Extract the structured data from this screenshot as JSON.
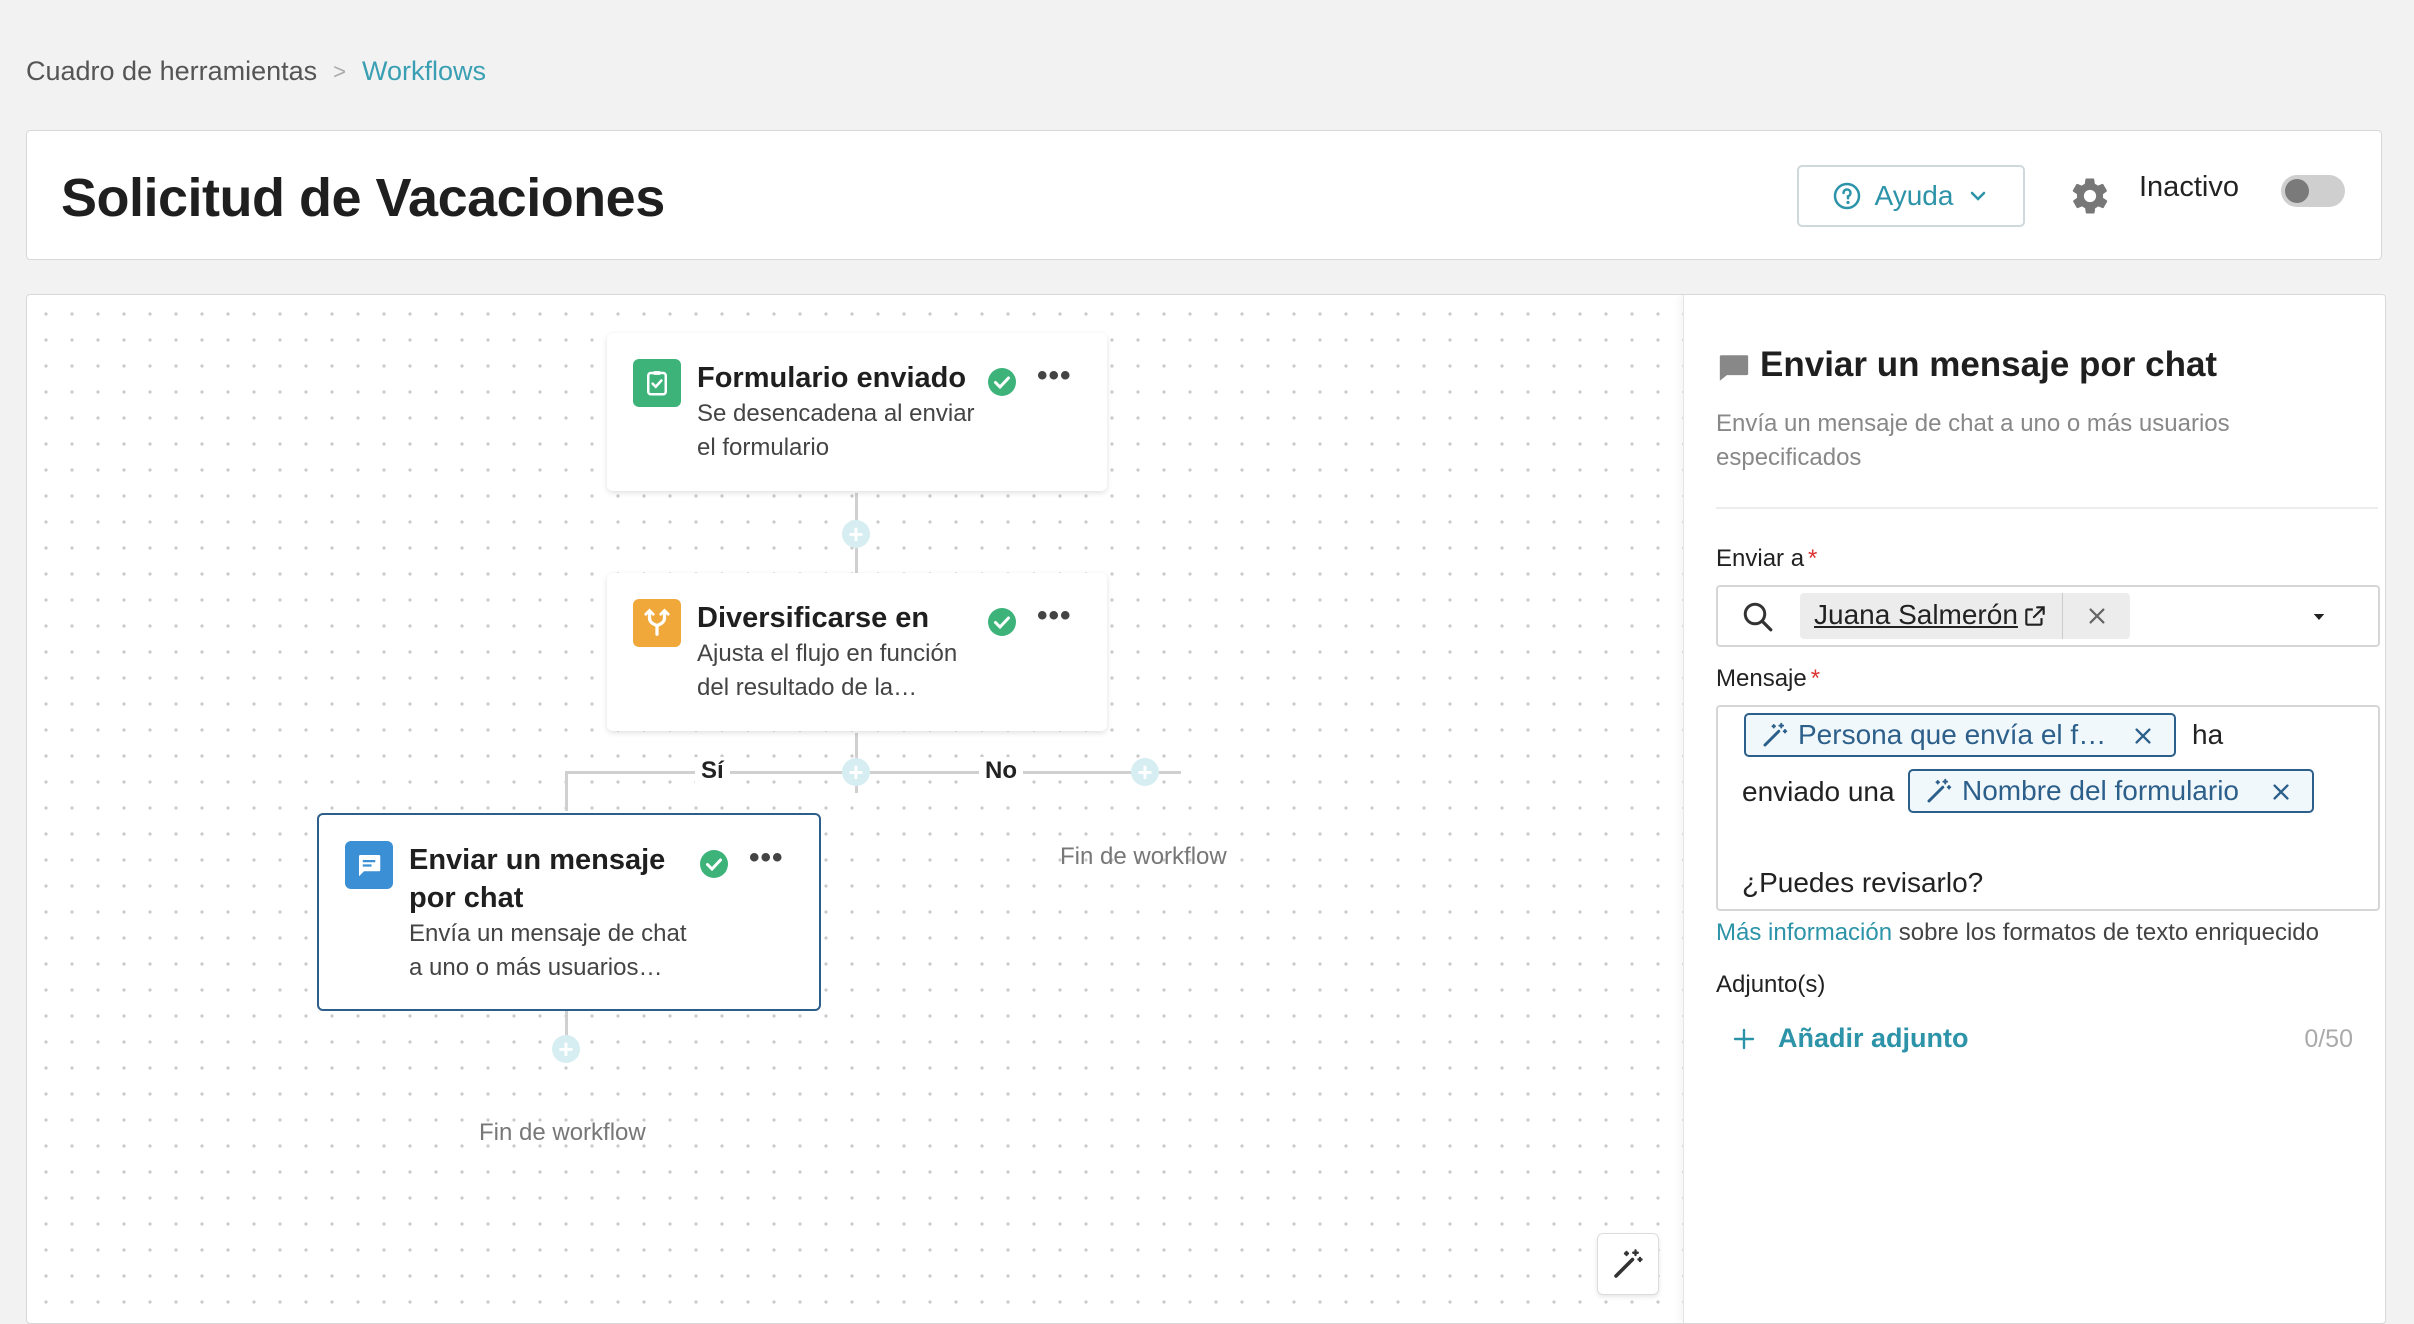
{
  "breadcrumb": {
    "root": "Cuadro de herramientas",
    "separator": ">",
    "current": "Workflows"
  },
  "header": {
    "title": "Solicitud de Vacaciones",
    "help_label": "Ayuda",
    "status_label": "Inactivo",
    "active": false
  },
  "canvas": {
    "nodes": [
      {
        "title": "Formulario enviado",
        "desc_line1": "Se desencadena al enviar",
        "desc_line2": "el formulario",
        "icon": "clipboard-check-icon",
        "color": "#3db37a"
      },
      {
        "title": "Diversificarse en",
        "desc_line1": "Ajusta el flujo en función",
        "desc_line2": "del resultado de la…",
        "icon": "branch-icon",
        "color": "#f0a83a"
      },
      {
        "title_line1": "Enviar un mensaje",
        "title_line2": "por chat",
        "desc_line1": "Envía un mensaje de chat",
        "desc_line2": "a uno o más usuarios…",
        "icon": "chat-icon",
        "color": "#3b8fd4"
      }
    ],
    "branch_yes": "Sí",
    "branch_no": "No",
    "end_label_no": "Fin de workflow",
    "end_label_yes": "Fin de workflow"
  },
  "panel": {
    "title": "Enviar un mensaje por chat",
    "description": "Envía un mensaje de chat a uno o más usuarios especificados",
    "send_to_label": "Enviar a",
    "recipient": "Juana Salmerón",
    "message_label": "Mensaje",
    "token_1": "Persona que envía el f…",
    "text_1": "ha",
    "text_2": "enviado una",
    "token_2": "Nombre del formulario",
    "text_3": "¿Puedes revisarlo?",
    "help_link": "Más información",
    "help_text": "sobre los formatos de texto enriquecido",
    "attachments_label": "Adjunto(s)",
    "add_attachment": "Añadir adjunto",
    "attachment_count": "0/50"
  },
  "required_mark": "*",
  "colors": {
    "accent": "#2c93a8",
    "selected_border": "#2c5f8a",
    "check": "#3db37a"
  }
}
